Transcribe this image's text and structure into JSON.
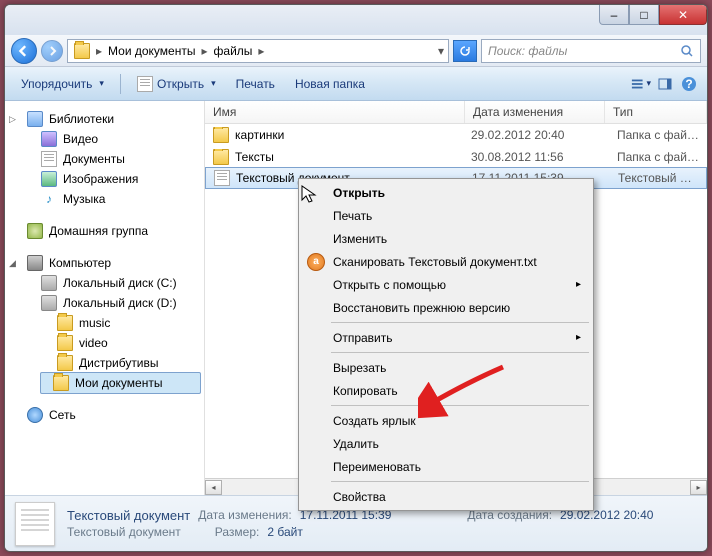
{
  "titlebar": {
    "min": "–",
    "max": "□",
    "close": "✕"
  },
  "address": {
    "crumbs": [
      "Мои документы",
      "файлы"
    ],
    "search_placeholder": "Поиск: файлы"
  },
  "toolbar": {
    "organize": "Упорядочить",
    "open": "Открыть",
    "print": "Печать",
    "new_folder": "Новая папка"
  },
  "columns": {
    "name": "Имя",
    "date": "Дата изменения",
    "type": "Тип"
  },
  "nav": {
    "libraries": "Библиотеки",
    "videos": "Видео",
    "documents": "Документы",
    "pictures": "Изображения",
    "music": "Музыка",
    "homegroup": "Домашняя группа",
    "computer": "Компьютер",
    "disk_c": "Локальный диск (C:)",
    "disk_d": "Локальный диск (D:)",
    "d_music": "music",
    "d_video": "video",
    "d_distr": "Дистрибутивы",
    "d_mydocs": "Мои документы",
    "network": "Сеть"
  },
  "rows": [
    {
      "name": "картинки",
      "date": "29.02.2012 20:40",
      "type": "Папка с файлами",
      "kind": "folder"
    },
    {
      "name": "Тексты",
      "date": "30.08.2012 11:56",
      "type": "Папка с файлами",
      "kind": "folder"
    },
    {
      "name": "Текстовый документ",
      "date": "17.11.2011 15:39",
      "type": "Текстовый докум...",
      "kind": "txt",
      "sel": true
    }
  ],
  "ctx": {
    "open": "Открыть",
    "print": "Печать",
    "edit": "Изменить",
    "scan": "Сканировать Текстовый документ.txt",
    "open_with": "Открыть с помощью",
    "restore": "Восстановить прежнюю версию",
    "send_to": "Отправить",
    "cut": "Вырезать",
    "copy": "Копировать",
    "shortcut": "Создать ярлык",
    "delete": "Удалить",
    "rename": "Переименовать",
    "properties": "Свойства"
  },
  "status": {
    "name": "Текстовый документ",
    "kind": "Текстовый документ",
    "modified_k": "Дата изменения:",
    "modified_v": "17.11.2011 15:39",
    "size_k": "Размер:",
    "size_v": "2 байт",
    "created_k": "Дата создания:",
    "created_v": "29.02.2012 20:40"
  }
}
